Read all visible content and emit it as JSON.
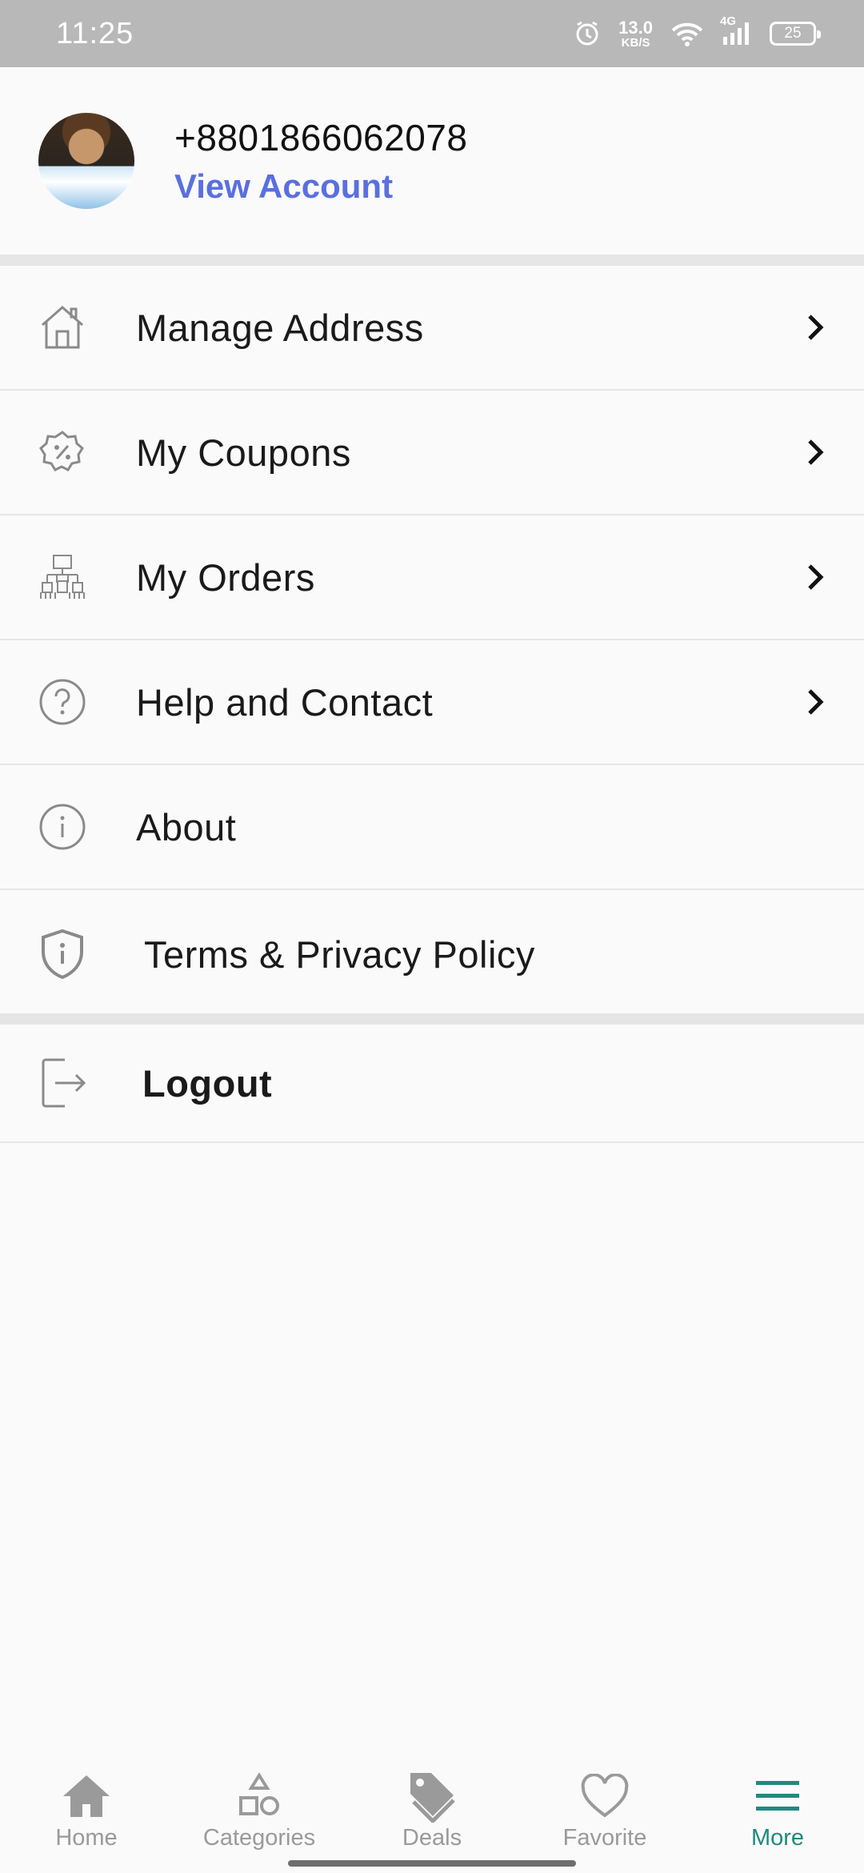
{
  "status_bar": {
    "time": "11:25",
    "net_speed_value": "13.0",
    "net_speed_unit": "KB/S",
    "network_label": "4G",
    "battery": "25",
    "icons": [
      "alarm-icon",
      "wifi-icon",
      "signal-icon",
      "battery-icon"
    ]
  },
  "profile": {
    "phone": "+8801866062078",
    "view_account": "View Account"
  },
  "menu": {
    "items": [
      {
        "label": "Manage Address",
        "icon": "home-icon",
        "chevron": true
      },
      {
        "label": "My Coupons",
        "icon": "coupon-badge-icon",
        "chevron": true
      },
      {
        "label": "My Orders",
        "icon": "orders-icon",
        "chevron": true
      },
      {
        "label": "Help and Contact",
        "icon": "help-circle-icon",
        "chevron": true
      },
      {
        "label": "About",
        "icon": "info-circle-icon",
        "chevron": false
      },
      {
        "label": "Terms & Privacy Policy",
        "icon": "shield-info-icon",
        "chevron": false
      }
    ],
    "logout": {
      "label": "Logout",
      "icon": "logout-icon"
    }
  },
  "bottom_nav": {
    "items": [
      {
        "label": "Home",
        "icon": "home-filled-icon"
      },
      {
        "label": "Categories",
        "icon": "shapes-icon"
      },
      {
        "label": "Deals",
        "icon": "tag-icon"
      },
      {
        "label": "Favorite",
        "icon": "heart-icon"
      },
      {
        "label": "More",
        "icon": "menu-icon"
      }
    ],
    "active": "More"
  },
  "colors": {
    "accent_link": "#5a6fe0",
    "active_nav": "#1f8a80",
    "status_bar": "#b8b8b8"
  }
}
